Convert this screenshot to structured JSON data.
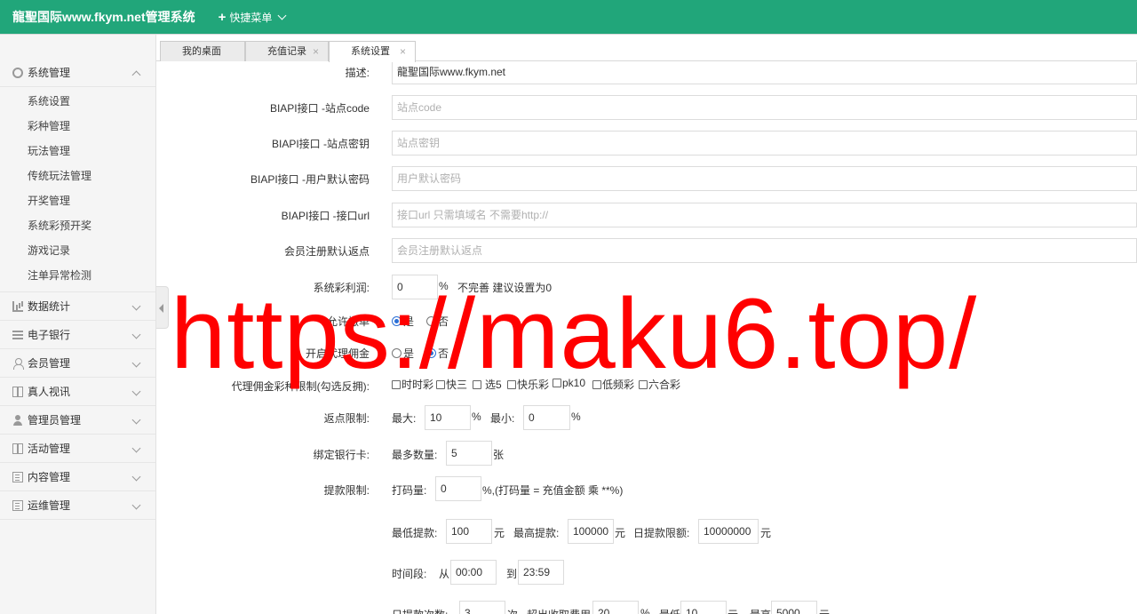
{
  "header": {
    "brand": "龍聖国际www.fkym.net管理系统",
    "quick_menu_label": "快捷菜单",
    "bg_color": "#21a67a"
  },
  "sidebar": {
    "groups": [
      {
        "label": "系统管理",
        "icon": "gear-icon",
        "expanded": true,
        "items": [
          "系统设置",
          "彩种管理",
          "玩法管理",
          "传统玩法管理",
          "开奖管理",
          "系统彩预开奖",
          "游戏记录",
          "注单异常检测"
        ]
      },
      {
        "label": "数据统计",
        "icon": "bar-chart-icon"
      },
      {
        "label": "电子银行",
        "icon": "list-icon"
      },
      {
        "label": "会员管理",
        "icon": "user-icon"
      },
      {
        "label": "真人视讯",
        "icon": "gift-icon"
      },
      {
        "label": "管理员管理",
        "icon": "person-icon"
      },
      {
        "label": "活动管理",
        "icon": "gift-icon"
      },
      {
        "label": "内容管理",
        "icon": "document-icon"
      },
      {
        "label": "运维管理",
        "icon": "document-icon"
      }
    ]
  },
  "tabs": [
    {
      "label": "我的桌面"
    },
    {
      "label": "充值记录"
    },
    {
      "label": "系统设置",
      "active": true
    }
  ],
  "form": {
    "desc": {
      "label": "描述:",
      "value": "龍聖国际www.fkym.net"
    },
    "site_code": {
      "label": "BIAPI接口 -站点code",
      "placeholder": "站点code"
    },
    "site_key": {
      "label": "BIAPI接口 -站点密钥",
      "placeholder": "站点密钥"
    },
    "default_pwd": {
      "label": "BIAPI接口 -用户默认密码",
      "placeholder": "用户默认密码"
    },
    "api_url": {
      "label": "BIAPI接口 -接口url",
      "placeholder": "接口url 只需填域名 不需要http://"
    },
    "rebate": {
      "label": "会员注册默认返点",
      "placeholder": "会员注册默认返点"
    },
    "profit": {
      "label": "系统彩利润:",
      "value": "0",
      "unit": "%",
      "note": "不完善 建议设置为0"
    },
    "cancel": {
      "label": "允许撤单",
      "opt_yes": "是",
      "opt_no": "否"
    },
    "agent_commission": {
      "label": "开启代理佣金",
      "opt_yes": "是",
      "opt_no": "否"
    },
    "agent_limit": {
      "label": "代理佣金彩种限制(勾选反拥):",
      "options": [
        "时时彩",
        "快三",
        "选5",
        "快乐彩",
        "pk10",
        "低频彩",
        "六合彩"
      ]
    },
    "rebate_limit": {
      "label": "返点限制:",
      "max_label": "最大:",
      "max_value": "10",
      "min_label": "最小:",
      "min_value": "0",
      "unit": "%"
    },
    "bind_card": {
      "label": "绑定银行卡:",
      "max_label": "最多数量:",
      "value": "5",
      "unit": "张"
    },
    "withdraw": {
      "label": "提款限制:",
      "bet_label": "打码量:",
      "bet_value": "0",
      "bet_note": "%,(打码量 = 充值金额 乘 **%)",
      "min_label": "最低提款:",
      "min_value": "100",
      "yuan": "元",
      "max_label": "最高提款:",
      "max_value": "100000",
      "daily_label": "日提款限额:",
      "daily_value": "10000000",
      "time_label": "时间段:",
      "from_label": "从",
      "from_value": "00:00",
      "to_label": "到",
      "to_value": "23:59",
      "count_label": "日提款次数:",
      "count_value": "3",
      "count_unit": "次",
      "fee_label": "超出收取费用",
      "fee_value": "20",
      "fee_unit": "%",
      "low_label": "最低",
      "low_value": "10",
      "high_label": "最高",
      "high_value": "5000"
    }
  },
  "watermark": "https://maku6.top/"
}
